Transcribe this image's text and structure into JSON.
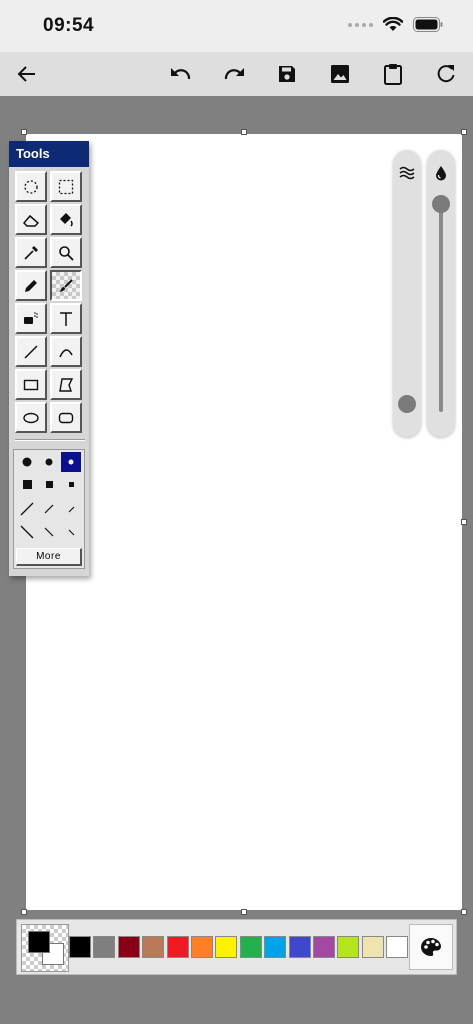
{
  "status": {
    "time": "09:54"
  },
  "tools_panel": {
    "title": "Tools",
    "tools": [
      {
        "name": "free-form-select"
      },
      {
        "name": "rect-select"
      },
      {
        "name": "eraser"
      },
      {
        "name": "fill-bucket"
      },
      {
        "name": "color-picker"
      },
      {
        "name": "magnifier"
      },
      {
        "name": "pencil"
      },
      {
        "name": "brush",
        "selected": true
      },
      {
        "name": "airbrush"
      },
      {
        "name": "text"
      },
      {
        "name": "line"
      },
      {
        "name": "curve"
      },
      {
        "name": "rectangle"
      },
      {
        "name": "polygon"
      },
      {
        "name": "ellipse"
      },
      {
        "name": "rounded-rectangle"
      }
    ],
    "more_label": "More"
  },
  "colors": {
    "foreground": "#000000",
    "background": "#ffffff",
    "swatches": [
      "#000000",
      "#7f7f7f",
      "#880015",
      "#b97a57",
      "#ed1c24",
      "#ff7f27",
      "#fff200",
      "#22b14c",
      "#00a2e8",
      "#3f48cc",
      "#a349a4",
      "#b5e61d",
      "#efe4b0",
      "#ffffff"
    ],
    "selected_option": "#0b108f"
  },
  "sliders": {
    "opacity_level": 0.0,
    "size_level": 1.0
  }
}
